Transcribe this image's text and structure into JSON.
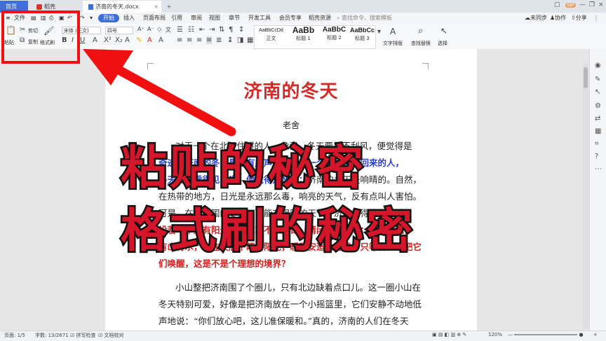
{
  "tabs": {
    "home": "首页",
    "daoke": "稻壳",
    "doc": "济南的冬天.docx",
    "add": "+"
  },
  "window": {
    "sync": "未同步",
    "collab": "协作",
    "share": "分享",
    "user": "SBF"
  },
  "menu": {
    "file": "文件",
    "items": [
      "开始",
      "插入",
      "页面布局",
      "引用",
      "审阅",
      "视图",
      "章节",
      "开发工具",
      "会员专享",
      "稻壳资源"
    ],
    "search_placeholder": "查找命令、搜索模板"
  },
  "ribbon": {
    "paste": "粘贴",
    "cut": "剪切",
    "copy": "复制",
    "format_painter": "格式刷",
    "font_name": "宋体 (正文)",
    "font_size": "四号",
    "styles": [
      {
        "sample": "AaBbCcDd",
        "name": "正文"
      },
      {
        "sample": "AaBb",
        "name": "标题 1"
      },
      {
        "sample": "AaBbC",
        "name": "标题 2"
      },
      {
        "sample": "AaBbCc",
        "name": "标题 3"
      }
    ],
    "text_layout": "文字排版",
    "find_replace": "查找替换",
    "select": "选择"
  },
  "document": {
    "title": "济南的冬天",
    "author": "老舍",
    "lines": [
      {
        "parts": [
          {
            "t": "对于一个在北平住惯的人，像我，冬天要是不刮风，便觉得是",
            "c": ""
          }
        ]
      },
      {
        "parts": [
          {
            "t": "奇迹；济南的冬天是没有风声的。对于一个刚由伦敦回来的人，",
            "c": "blue"
          }
        ]
      },
      {
        "parts": [
          {
            "t": "冬天要能看得见日光，便觉得是怪事；",
            "c": "blue"
          },
          {
            "t": "济南的冬天是响晴的。自然，",
            "c": ""
          }
        ]
      },
      {
        "parts": [
          {
            "t": "在热带的地方，日光是永远那么毒，响亮的天气，反有点叫人害怕。",
            "c": ""
          }
        ]
      },
      {
        "parts": [
          {
            "t": "可是，在北中国的冬天，而能有温晴的天气，济南真得算个宝地。",
            "c": ""
          }
        ]
      },
      {
        "parts": [
          {
            "t": "设若单单是有阳光，那也算不了出奇。请闭上眼睛想：一个老城，",
            "c": "red"
          }
        ]
      },
      {
        "parts": [
          {
            "t": "有山有水，全在天底下晒着阳光，暖和安适地睡着，只等春风来把它",
            "c": "red"
          }
        ]
      },
      {
        "parts": [
          {
            "t": "们唤醒，这是不是个理想的境界？",
            "c": "red"
          }
        ]
      },
      {
        "parts": [
          {
            "t": "小山整把济南围了个圈儿，只有北边缺着点口儿。这一圈小山在",
            "c": ""
          }
        ]
      },
      {
        "parts": [
          {
            "t": "冬天特别可爱，好像是把济南放在一个小摇篮里，它们安静不动地低",
            "c": ""
          }
        ]
      },
      {
        "parts": [
          {
            "t": "声地说：“你们放心吧，这儿准保暖和。”真的，济南的人们在冬天",
            "c": ""
          }
        ]
      }
    ]
  },
  "overlay": {
    "line1": "粘贴的秘密",
    "line2": "格式刷的秘密"
  },
  "status": {
    "page": "页面: 1/5",
    "words": "字数: 13/2671",
    "spell": "拼写检查",
    "proof": "文档校对",
    "zoom": "120%"
  },
  "colors": {
    "accent": "#3d6fd9",
    "title_red": "#d42a2a",
    "overlay_red": "#d4152a",
    "box_red": "#f01010"
  }
}
